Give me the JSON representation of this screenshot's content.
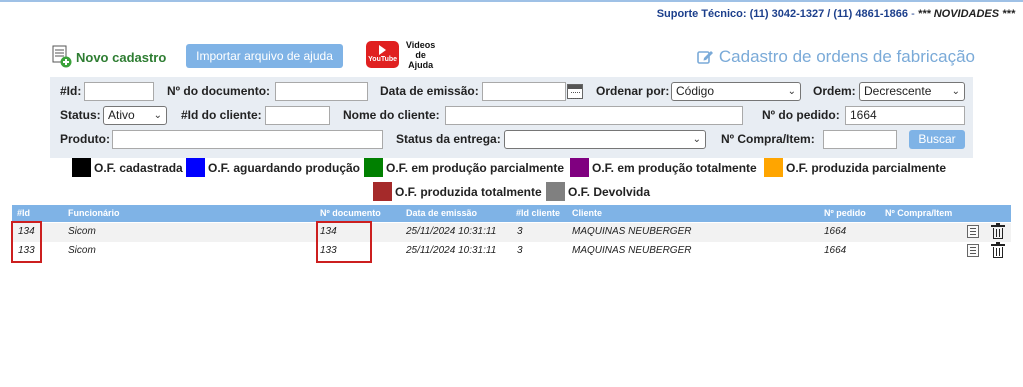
{
  "header": {
    "support_label": "Suporte Técnico:",
    "phones": "(11) 3042-1327 / (11) 4861-1866",
    "separator": "-",
    "news": "*** NOVIDADES ***"
  },
  "toolbar": {
    "new_label": "Novo cadastro",
    "import_label": "Importar arquivo de ajuda",
    "video_top": "Videos",
    "video_bottom": "de Ajuda",
    "youtube_label": "YouTube"
  },
  "page_title": "Cadastro de ordens de fabricação",
  "filters": {
    "id_label": "#Id:",
    "id_value": "",
    "doc_label": "Nº do documento:",
    "doc_value": "",
    "date_label": "Data de emissão:",
    "date_value": "",
    "order_by_label": "Ordenar por:",
    "order_by_value": "Código",
    "order_label": "Ordem:",
    "order_value": "Decrescente",
    "status_label": "Status:",
    "status_value": "Ativo",
    "client_id_label": "#Id do cliente:",
    "client_id_value": "",
    "client_name_label": "Nome do cliente:",
    "client_name_value": "",
    "order_no_label": "Nº do pedido:",
    "order_no_value": "1664",
    "product_label": "Produto:",
    "product_value": "",
    "delivery_label": "Status da entrega:",
    "delivery_value": "",
    "purchase_label": "Nº Compra/Item:",
    "purchase_value": "",
    "search_label": "Buscar"
  },
  "legend": [
    {
      "label": "O.F. cadastrada",
      "color": "#000000"
    },
    {
      "label": "O.F. aguardando produção",
      "color": "#0000ff"
    },
    {
      "label": "O.F. em produção parcialmente",
      "color": "#008000"
    },
    {
      "label": "O.F. em produção totalmente",
      "color": "#800080"
    },
    {
      "label": "O.F. produzida parcialmente",
      "color": "#ffa500"
    },
    {
      "label": "O.F. produzida totalmente",
      "color": "#a52a2a"
    },
    {
      "label": "O.F. Devolvida",
      "color": "#808080"
    }
  ],
  "table": {
    "columns": [
      "#Id",
      "Funcionário",
      "Nº documento",
      "Data de emissão",
      "#Id cliente",
      "Cliente",
      "Nº pedido",
      "Nº Compra/Item"
    ],
    "rows": [
      {
        "id": "134",
        "employee": "Sicom",
        "doc": "134",
        "date": "25/11/2024 10:31:11",
        "client_id": "3",
        "client": "MAQUINAS NEUBERGER",
        "order": "1664",
        "purchase": ""
      },
      {
        "id": "133",
        "employee": "Sicom",
        "doc": "133",
        "date": "25/11/2024 10:31:11",
        "client_id": "3",
        "client": "MAQUINAS NEUBERGER",
        "order": "1664",
        "purchase": ""
      }
    ]
  },
  "colors": {
    "accent": "#7fb3e6",
    "highlight": "#cc1f1f",
    "support_text": "#1c3f8c",
    "new_button_text": "#2e7d32"
  }
}
